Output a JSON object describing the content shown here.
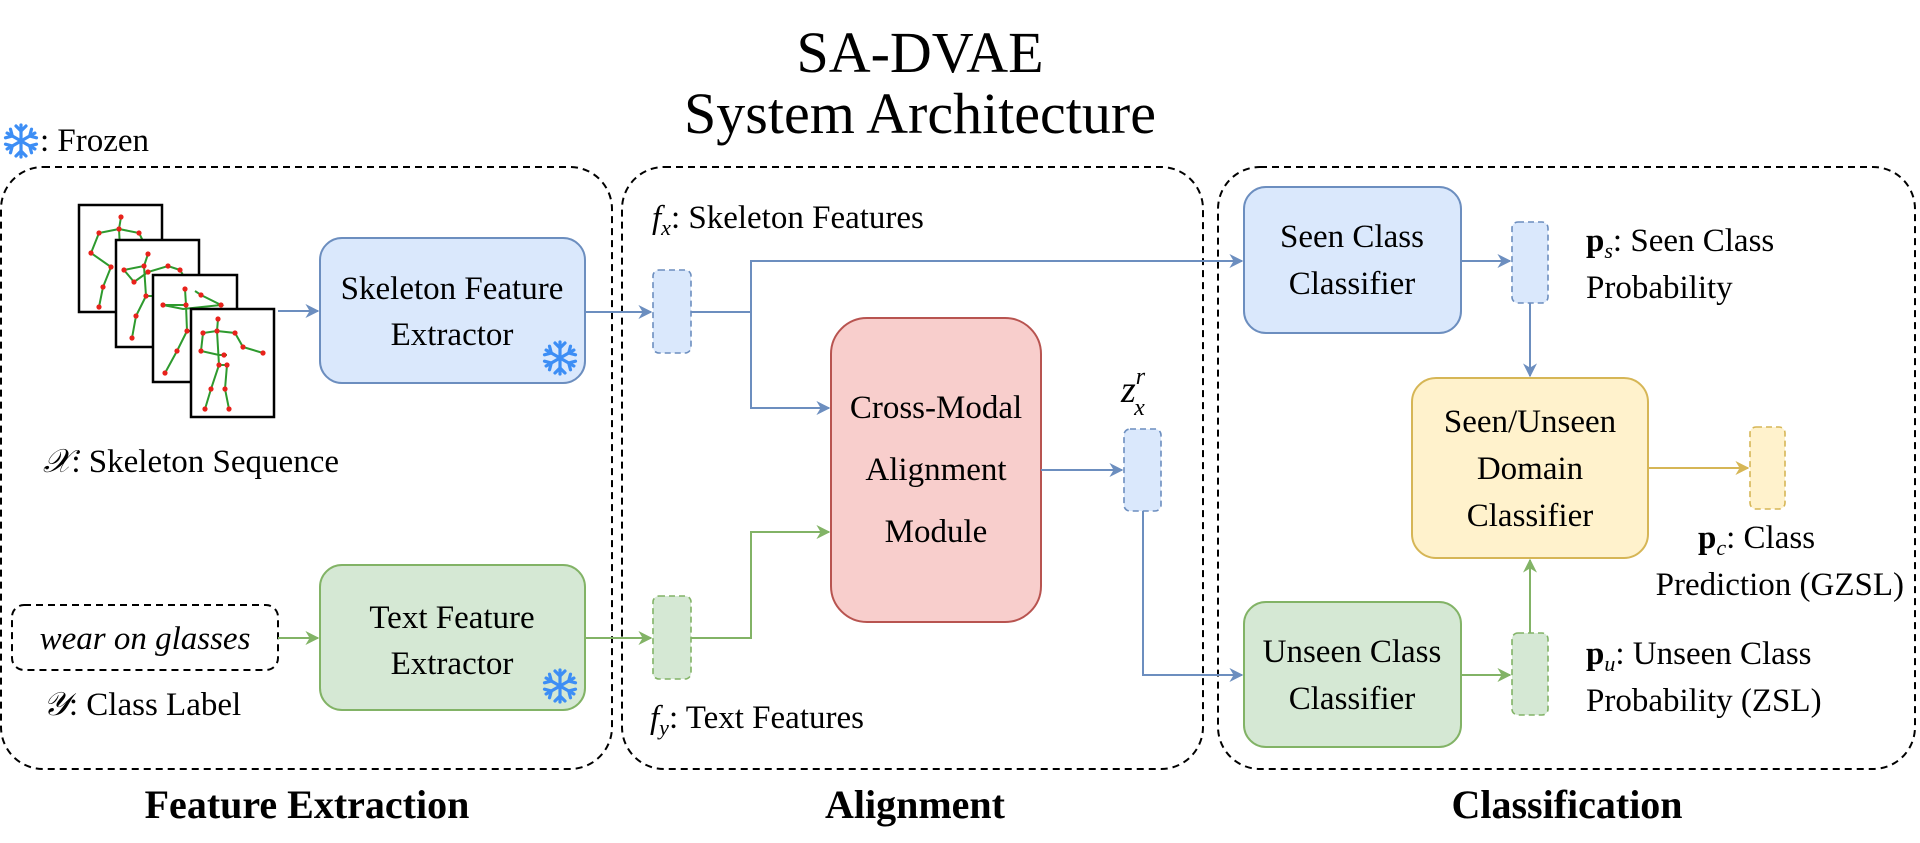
{
  "title": {
    "line1": "SA-DVAE",
    "line2": "System Architecture"
  },
  "legend": {
    "icon": "snowflake-icon",
    "label": ": Frozen"
  },
  "colors": {
    "blue_fill": "#dae8fc",
    "blue_stroke": "#6c8ebf",
    "green_fill": "#d5e8d4",
    "green_stroke": "#82b366",
    "red_fill": "#f8cecc",
    "red_stroke": "#b85450",
    "yellow_fill": "#fff2cc",
    "yellow_stroke": "#d6b656",
    "frozen_icon": "#3d8ef5",
    "skeleton_bone": "#2e9a2e",
    "skeleton_joint": "#e8221b"
  },
  "sections": {
    "feature_extraction": "Feature Extraction",
    "alignment": "Alignment",
    "classification": "Classification"
  },
  "feature_extraction": {
    "skeleton_extractor": {
      "line1": "Skeleton Feature",
      "line2": "Extractor",
      "frozen": true
    },
    "text_extractor": {
      "line1": "Text Feature",
      "line2": "Extractor",
      "frozen": true
    },
    "skeleton_input": {
      "symbol": "𝒳",
      "label": ": Skeleton Sequence",
      "frames": 4
    },
    "text_input": {
      "value": "wear on glasses",
      "symbol": "𝒴",
      "label": ": Class Label"
    }
  },
  "alignment": {
    "fx": {
      "symbol": "f",
      "sub": "x",
      "label": ": Skeleton Features"
    },
    "fy": {
      "symbol": "f",
      "sub": "y",
      "label": ": Text Features"
    },
    "module": {
      "line1": "Cross-Modal",
      "line2": "Alignment",
      "line3": "Module"
    },
    "z": {
      "symbol": "z",
      "sup": "r",
      "sub": "x"
    }
  },
  "classification": {
    "seen_classifier": {
      "line1": "Seen Class",
      "line2": "Classifier"
    },
    "unseen_classifier": {
      "line1": "Unseen Class",
      "line2": "Classifier"
    },
    "domain_classifier": {
      "line1": "Seen/Unseen",
      "line2": "Domain",
      "line3": "Classifier"
    },
    "ps": {
      "symbol": "p",
      "sub": "s",
      "line1": ": Seen Class",
      "line2": "Probability"
    },
    "pu": {
      "symbol": "p",
      "sub": "u",
      "line1": ": Unseen Class",
      "line2": "Probability (ZSL)"
    },
    "pc": {
      "symbol": "p",
      "sub": "c",
      "line1": ": Class",
      "line2": "Prediction (GZSL)"
    }
  }
}
